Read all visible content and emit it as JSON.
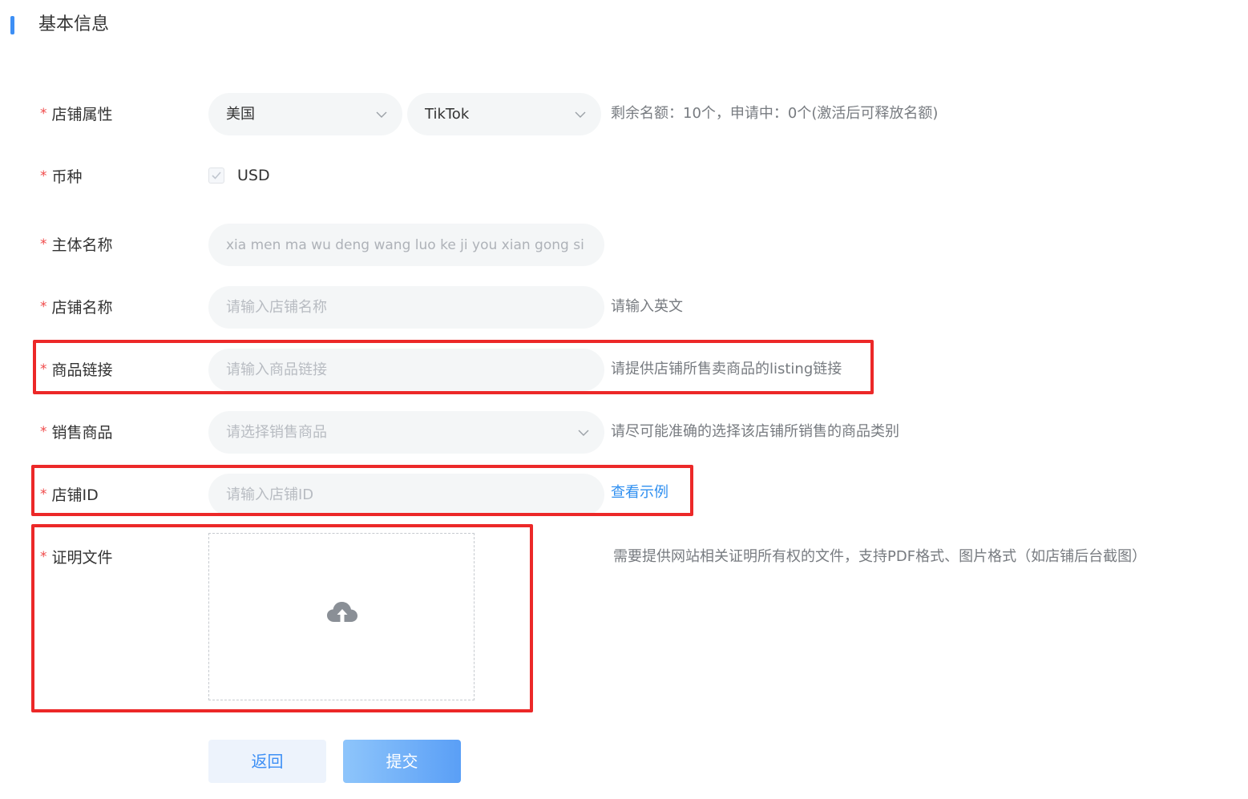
{
  "section": {
    "title": "基本信息"
  },
  "form": {
    "store_attr": {
      "label": "店铺属性",
      "country": "美国",
      "platform": "TikTok",
      "hint": "剩余名额：10个，申请中：0个(激活后可释放名额)"
    },
    "currency": {
      "label": "币种",
      "option": "USD",
      "checked": true
    },
    "entity_name": {
      "label": "主体名称",
      "value": "xia men ma wu deng wang luo ke ji you xian gong si"
    },
    "store_name": {
      "label": "店铺名称",
      "placeholder": "请输入店铺名称",
      "hint": "请输入英文"
    },
    "product_link": {
      "label": "商品链接",
      "placeholder": "请输入商品链接",
      "hint": "请提供店铺所售卖商品的listing链接"
    },
    "sales_goods": {
      "label": "销售商品",
      "placeholder": "请选择销售商品",
      "hint": "请尽可能准确的选择该店铺所销售的商品类别"
    },
    "store_id": {
      "label": "店铺ID",
      "placeholder": "请输入店铺ID",
      "link": "查看示例"
    },
    "proof_file": {
      "label": "证明文件",
      "hint": "需要提供网站相关证明所有权的文件，支持PDF格式、图片格式（如店铺后台截图）"
    },
    "required_mark": "*"
  },
  "buttons": {
    "back": "返回",
    "submit": "提交"
  },
  "colors": {
    "accent": "#3d8ff5",
    "required": "#f04a4a",
    "highlight": "#ec2828",
    "input_bg": "#f4f6f7"
  },
  "icons": {
    "chevron": "chevron-down-icon",
    "checkbox": "checkmark-icon",
    "upload": "cloud-upload-icon"
  }
}
